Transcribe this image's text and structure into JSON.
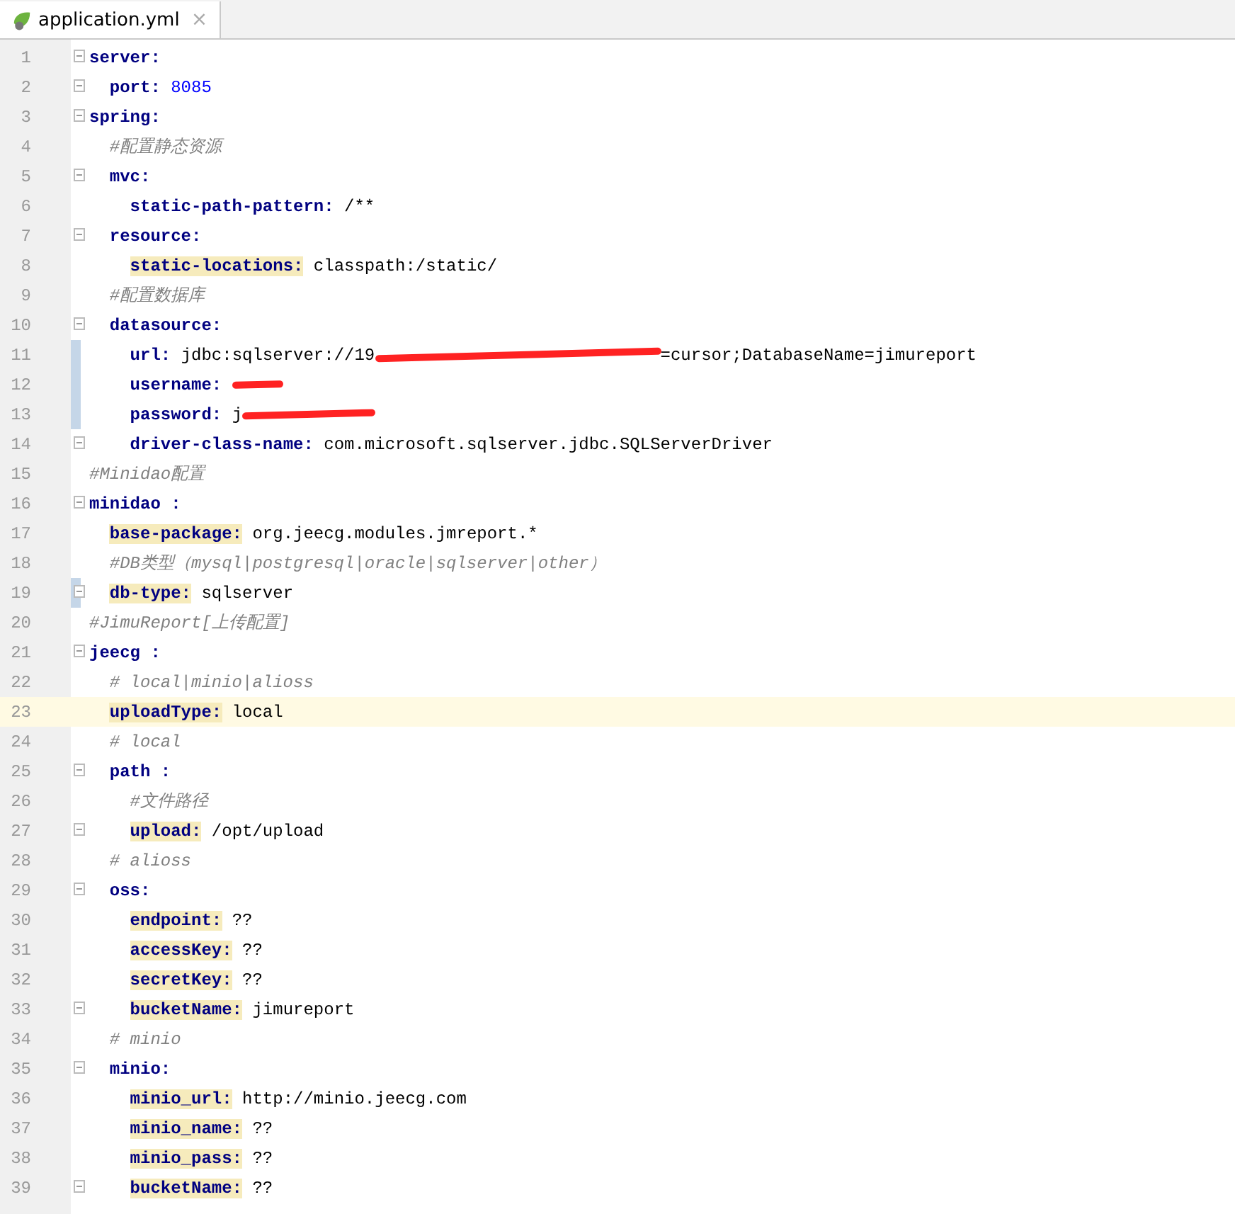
{
  "tab": {
    "label": "application.yml",
    "selected": true,
    "close": "×"
  },
  "lines": [
    {
      "number": "1",
      "fold": true,
      "changed": false,
      "current": false,
      "tokens": [
        {
          "kind": "key",
          "text": "server:"
        }
      ],
      "children": [
        {
          "number": "2",
          "fold": true,
          "changed": false,
          "current": false,
          "tokens": [
            {
              "kind": "key",
              "text": "port:"
            },
            {
              "kind": "number",
              "text": "8085"
            }
          ]
        }
      ]
    },
    {
      "number": "3",
      "fold": true,
      "changed": false,
      "current": false,
      "tokens": [
        {
          "kind": "key",
          "text": "spring:"
        }
      ],
      "children": [
        {
          "number": "4",
          "fold": false,
          "changed": false,
          "current": false,
          "tokens": [
            {
              "kind": "comment",
              "text": "#配置静态资源"
            }
          ]
        },
        {
          "number": "5",
          "fold": true,
          "changed": false,
          "current": false,
          "tokens": [
            {
              "kind": "key",
              "text": "mvc:"
            }
          ],
          "children": [
            {
              "number": "6",
              "fold": false,
              "changed": false,
              "current": false,
              "tokens": [
                {
                  "kind": "key",
                  "text": "static-path-pattern:"
                },
                {
                  "kind": "plain",
                  "text": "/**"
                }
              ]
            }
          ]
        },
        {
          "number": "7",
          "fold": true,
          "changed": false,
          "current": false,
          "tokens": [
            {
              "kind": "key",
              "text": "resource:"
            }
          ],
          "children": [
            {
              "number": "8",
              "fold": false,
              "changed": false,
              "current": false,
              "tokens": [
                {
                  "kind": "marked_key",
                  "text": "static-locations:"
                },
                {
                  "kind": "plain",
                  "text": "classpath:/static/"
                }
              ]
            }
          ]
        },
        {
          "number": "9",
          "fold": false,
          "changed": false,
          "current": false,
          "tokens": [
            {
              "kind": "comment",
              "text": "#配置数据库"
            }
          ]
        },
        {
          "number": "10",
          "fold": true,
          "changed": false,
          "current": false,
          "tokens": [
            {
              "kind": "key",
              "text": "datasource:"
            }
          ],
          "children": [
            {
              "number": "11",
              "fold": false,
              "changed": true,
              "current": false,
              "tokens": [
                {
                  "kind": "key",
                  "text": "url:"
                },
                {
                  "kind": "plain",
                  "text": "jdbc:sqlserver://19"
                },
                {
                  "kind": "redacted_long"
                },
                {
                  "kind": "plain",
                  "text": "=cursor;DatabaseName=jimureport"
                }
              ]
            },
            {
              "number": "12",
              "fold": false,
              "changed": true,
              "current": false,
              "tokens": [
                {
                  "kind": "key",
                  "text": "username:"
                },
                {
                  "kind": "redacted_short"
                }
              ]
            },
            {
              "number": "13",
              "fold": false,
              "changed": true,
              "current": false,
              "tokens": [
                {
                  "kind": "key",
                  "text": "password:"
                },
                {
                  "kind": "plain",
                  "text": "j"
                },
                {
                  "kind": "redacted_medium"
                }
              ]
            },
            {
              "number": "14",
              "fold": true,
              "changed": false,
              "current": false,
              "tokens": [
                {
                  "kind": "key",
                  "text": "driver-class-name:"
                },
                {
                  "kind": "plain",
                  "text": "com.microsoft.sqlserver.jdbc.SQLServerDriver"
                }
              ]
            }
          ]
        }
      ]
    },
    {
      "number": "15",
      "fold": false,
      "changed": false,
      "current": false,
      "tokens": [
        {
          "kind": "comment",
          "text": "#Minidao配置"
        }
      ]
    },
    {
      "number": "16",
      "fold": true,
      "changed": false,
      "current": false,
      "tokens": [
        {
          "kind": "key",
          "text": "minidao :"
        }
      ],
      "children": [
        {
          "number": "17",
          "fold": false,
          "changed": false,
          "current": false,
          "tokens": [
            {
              "kind": "marked_key",
              "text": "base-package:"
            },
            {
              "kind": "plain",
              "text": "org.jeecg.modules.jmreport.*"
            }
          ]
        },
        {
          "number": "18",
          "fold": false,
          "changed": false,
          "current": false,
          "tokens": [
            {
              "kind": "comment",
              "text": "#DB类型（mysql|postgresql|oracle|sqlserver|other）"
            }
          ]
        },
        {
          "number": "19",
          "fold": true,
          "changed": true,
          "current": false,
          "tokens": [
            {
              "kind": "marked_key",
              "text": "db-type:"
            },
            {
              "kind": "plain",
              "text": "sqlserver"
            }
          ]
        }
      ]
    },
    {
      "number": "20",
      "fold": false,
      "changed": false,
      "current": false,
      "tokens": [
        {
          "kind": "comment",
          "text": "#JimuReport[上传配置]"
        }
      ]
    },
    {
      "number": "21",
      "fold": true,
      "changed": false,
      "current": false,
      "tokens": [
        {
          "kind": "key",
          "text": "jeecg :"
        }
      ],
      "children": [
        {
          "number": "22",
          "fold": false,
          "changed": false,
          "current": false,
          "tokens": [
            {
              "kind": "comment",
              "text": "# local|minio|alioss"
            }
          ]
        },
        {
          "number": "23",
          "fold": false,
          "changed": false,
          "current": true,
          "tokens": [
            {
              "kind": "marked_key",
              "text": "uploadType:"
            },
            {
              "kind": "plain",
              "text": "local"
            }
          ]
        },
        {
          "number": "24",
          "fold": false,
          "changed": false,
          "current": false,
          "tokens": [
            {
              "kind": "comment",
              "text": "# local"
            }
          ]
        },
        {
          "number": "25",
          "fold": true,
          "changed": false,
          "current": false,
          "tokens": [
            {
              "kind": "key",
              "text": "path :"
            }
          ],
          "children": [
            {
              "number": "26",
              "fold": false,
              "changed": false,
              "current": false,
              "tokens": [
                {
                  "kind": "comment",
                  "text": "#文件路径"
                }
              ]
            },
            {
              "number": "27",
              "fold": true,
              "changed": false,
              "current": false,
              "tokens": [
                {
                  "kind": "marked_key",
                  "text": "upload:"
                },
                {
                  "kind": "plain",
                  "text": "/opt/upload"
                }
              ]
            }
          ]
        },
        {
          "number": "28",
          "fold": false,
          "changed": false,
          "current": false,
          "tokens": [
            {
              "kind": "comment",
              "text": "# alioss"
            }
          ]
        },
        {
          "number": "29",
          "fold": true,
          "changed": false,
          "current": false,
          "tokens": [
            {
              "kind": "key",
              "text": "oss:"
            }
          ],
          "children": [
            {
              "number": "30",
              "fold": false,
              "changed": false,
              "current": false,
              "tokens": [
                {
                  "kind": "marked_key",
                  "text": "endpoint:"
                },
                {
                  "kind": "plain",
                  "text": "??"
                }
              ]
            },
            {
              "number": "31",
              "fold": false,
              "changed": false,
              "current": false,
              "tokens": [
                {
                  "kind": "marked_key",
                  "text": "accessKey:"
                },
                {
                  "kind": "plain",
                  "text": "??"
                }
              ]
            },
            {
              "number": "32",
              "fold": false,
              "changed": false,
              "current": false,
              "tokens": [
                {
                  "kind": "marked_key",
                  "text": "secretKey:"
                },
                {
                  "kind": "plain",
                  "text": "??"
                }
              ]
            },
            {
              "number": "33",
              "fold": true,
              "changed": false,
              "current": false,
              "tokens": [
                {
                  "kind": "marked_key",
                  "text": "bucketName:"
                },
                {
                  "kind": "plain",
                  "text": "jimureport"
                }
              ]
            }
          ]
        },
        {
          "number": "34",
          "fold": false,
          "changed": false,
          "current": false,
          "tokens": [
            {
              "kind": "comment",
              "text": "# minio"
            }
          ]
        },
        {
          "number": "35",
          "fold": true,
          "changed": false,
          "current": false,
          "tokens": [
            {
              "kind": "key",
              "text": "minio:"
            }
          ],
          "children": [
            {
              "number": "36",
              "fold": false,
              "changed": false,
              "current": false,
              "tokens": [
                {
                  "kind": "marked_key",
                  "text": "minio_url:"
                },
                {
                  "kind": "plain",
                  "text": "http://minio.jeecg.com"
                }
              ]
            },
            {
              "number": "37",
              "fold": false,
              "changed": false,
              "current": false,
              "tokens": [
                {
                  "kind": "marked_key",
                  "text": "minio_name:"
                },
                {
                  "kind": "plain",
                  "text": "??"
                }
              ]
            },
            {
              "number": "38",
              "fold": false,
              "changed": false,
              "current": false,
              "tokens": [
                {
                  "kind": "marked_key",
                  "text": "minio_pass:"
                },
                {
                  "kind": "plain",
                  "text": "??"
                }
              ]
            },
            {
              "number": "39",
              "fold": true,
              "changed": false,
              "current": false,
              "tokens": [
                {
                  "kind": "marked_key",
                  "text": "bucketName:"
                },
                {
                  "kind": "plain",
                  "text": "??"
                }
              ]
            }
          ]
        }
      ]
    }
  ]
}
